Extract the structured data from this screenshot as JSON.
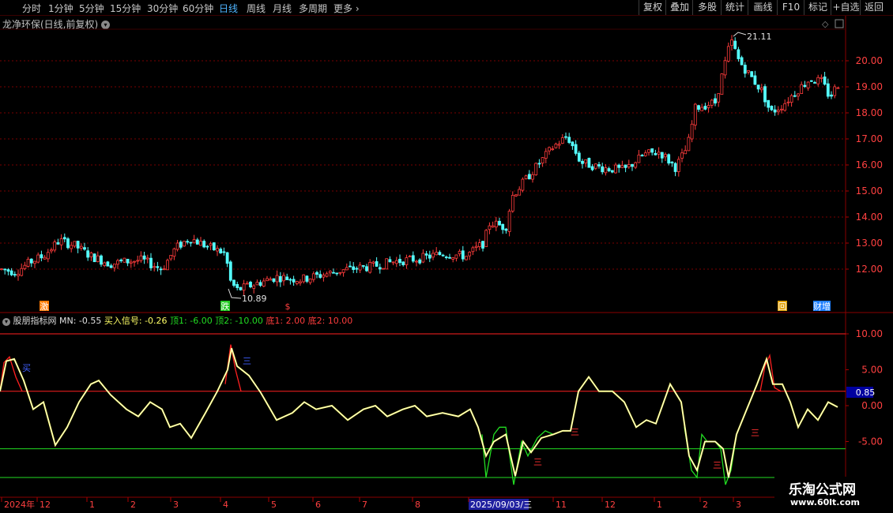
{
  "toolbar": {
    "periods": [
      "分时",
      "1分钟",
      "5分钟",
      "15分钟",
      "30分钟",
      "60分钟",
      "日线",
      "周线",
      "月线",
      "多周期",
      "更多"
    ],
    "active_period": "日线",
    "right_buttons": [
      "复权",
      "叠加",
      "多股",
      "统计",
      "画线",
      "F10",
      "标记",
      "+自选",
      "返回"
    ]
  },
  "main_chart": {
    "title": "龙净环保(日线,前复权)",
    "price_axis": [
      "20.00",
      "19.00",
      "18.00",
      "17.00",
      "16.00",
      "15.00",
      "14.00",
      "13.00",
      "12.00"
    ],
    "high_label": "21.11",
    "low_label": "10.89",
    "markers": [
      "激",
      "跌",
      "$",
      "回",
      "财增"
    ]
  },
  "indicator": {
    "name": "股朋指标网",
    "values_text": "MN: -0.55",
    "buy_signal": "买入信号: -0.26",
    "top1": "顶1: -6.00",
    "top2": "顶2: -10.00",
    "bottom1": "底1: 2.00",
    "bottom2": "底2: 10.00",
    "axis": [
      "10.00",
      "5.00",
      "0.00",
      "-5.00"
    ],
    "current_value": "0.85",
    "buy_label": "买",
    "signal_glyph": "三"
  },
  "time_axis": [
    "2024年",
    "12",
    "1",
    "2",
    "3",
    "4",
    "5",
    "6",
    "7",
    "8",
    "9",
    "2025/09/03/三",
    "11",
    "12",
    "1",
    "2",
    "3"
  ],
  "watermark": {
    "line1": "乐淘公式网",
    "line2": "www.60lt.com"
  },
  "colors": {
    "up": "#ff3c3c",
    "down": "#54ffff",
    "yellow": "#ffff66",
    "green": "#22dd22",
    "red_line": "#ff2020",
    "grid": "#7a0000",
    "active": "#4fb4ff"
  }
}
